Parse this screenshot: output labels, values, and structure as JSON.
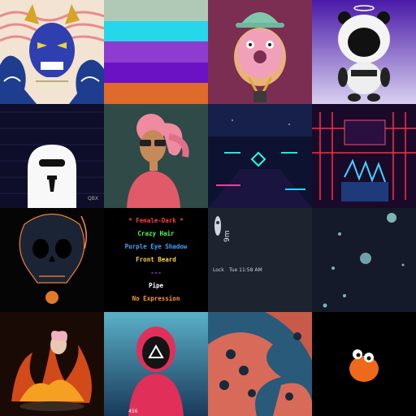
{
  "grid": {
    "palette_stripes": [
      "#b0c9b6",
      "#26d6ea",
      "#8e3bd0",
      "#6c12c5",
      "#e06a2a"
    ],
    "traits": [
      {
        "text": "* Female-Dark *",
        "color": "#ff3b3b"
      },
      {
        "text": "Crazy Hair",
        "color": "#44ff44"
      },
      {
        "text": "Purple Eye Shadow",
        "color": "#2fa8ff"
      },
      {
        "text": "Front Beard",
        "color": "#ffd23a"
      },
      {
        "text": "---",
        "color": "#b040ff"
      },
      {
        "text": "Pipe",
        "color": "#ffffff"
      },
      {
        "text": "No Expression",
        "color": "#ff9a1a"
      }
    ],
    "phone_time_text": "Tue 11:58 AM",
    "phone_label_text": "Lock",
    "ghost_tag": "QBX",
    "soldier_tag": "456"
  }
}
